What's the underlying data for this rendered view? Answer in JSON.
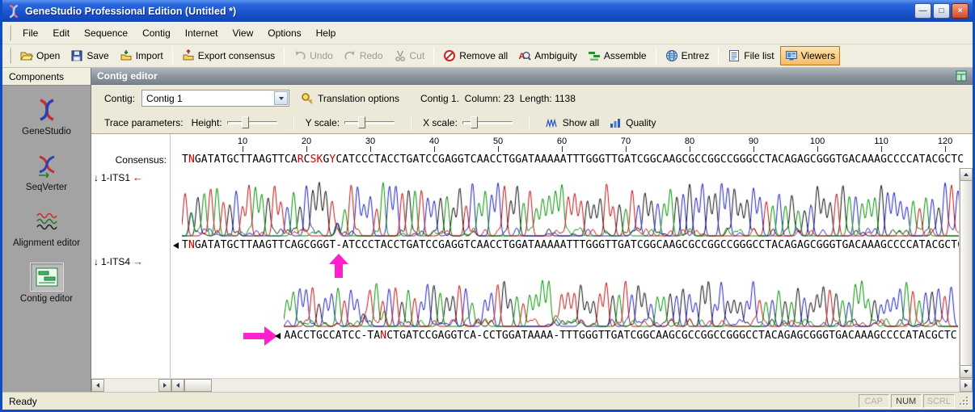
{
  "window": {
    "title": "GeneStudio Professional Edition (Untitled *)",
    "controls": {
      "minimize": "—",
      "restore": "□",
      "close": "×"
    }
  },
  "menu": [
    "File",
    "Edit",
    "Sequence",
    "Contig",
    "Internet",
    "View",
    "Options",
    "Help"
  ],
  "toolbar": [
    {
      "type": "button",
      "label": "Open",
      "icon": "open",
      "enabled": true
    },
    {
      "type": "button",
      "label": "Save",
      "icon": "save",
      "enabled": true
    },
    {
      "type": "button",
      "label": "Import",
      "icon": "import",
      "enabled": true
    },
    {
      "type": "sep"
    },
    {
      "type": "button",
      "label": "Export consensus",
      "icon": "export",
      "enabled": true
    },
    {
      "type": "sep"
    },
    {
      "type": "button",
      "label": "Undo",
      "icon": "undo",
      "enabled": false
    },
    {
      "type": "button",
      "label": "Redo",
      "icon": "redo",
      "enabled": false
    },
    {
      "type": "button",
      "label": "Cut",
      "icon": "cut",
      "enabled": false
    },
    {
      "type": "sep"
    },
    {
      "type": "button",
      "label": "Remove all",
      "icon": "remove",
      "enabled": true
    },
    {
      "type": "button",
      "label": "Ambiguity",
      "icon": "ambiguity",
      "enabled": true
    },
    {
      "type": "button",
      "label": "Assemble",
      "icon": "assemble",
      "enabled": true
    },
    {
      "type": "sep"
    },
    {
      "type": "button",
      "label": "Entrez",
      "icon": "entrez",
      "enabled": true
    },
    {
      "type": "sep"
    },
    {
      "type": "button",
      "label": "File list",
      "icon": "filelist",
      "enabled": true
    },
    {
      "type": "button",
      "label": "Viewers",
      "icon": "viewers",
      "enabled": true,
      "active": true
    }
  ],
  "sidebar": {
    "header": "Components",
    "items": [
      {
        "label": "GeneStudio",
        "icon": "genestudio",
        "selected": false
      },
      {
        "label": "SeqVerter",
        "icon": "seqverter",
        "selected": false
      },
      {
        "label": "Alignment editor",
        "icon": "alignment",
        "selected": false
      },
      {
        "label": "Contig editor",
        "icon": "contig",
        "selected": true
      }
    ]
  },
  "panel": {
    "title": "Contig editor",
    "contig_label": "Contig:",
    "contig_value": "Contig 1",
    "translation_options": "Translation options",
    "info": "Contig 1.  Column: 23  Length: 1138",
    "trace_params": {
      "label": "Trace parameters:",
      "sliders": [
        {
          "label": "Height:",
          "value": 30
        },
        {
          "label": "Y scale:",
          "value": 28
        },
        {
          "label": "X scale:",
          "value": 16
        }
      ],
      "buttons": [
        {
          "label": "Show all",
          "icon": "showall"
        },
        {
          "label": "Quality",
          "icon": "quality"
        }
      ]
    },
    "ruler": {
      "start": 10,
      "end": 120,
      "step": 10
    },
    "consensus_label": "Consensus:",
    "consensus": "TNGATATGCTTAAGTTCARCSKGYCATCCCTACCTGATCCGAGGTCAACCTGGATAAAAATTTGGGTTGATCGGCAAGCGCCGGCCGGGCCTACAGAGCGGGTGACAAAGCCCCATACGCTC",
    "expander": "↓",
    "reads": [
      {
        "name": "1-ITS1",
        "arrow": "←",
        "arrow_color": "#cc0000",
        "offset": 0,
        "sequence": "TNGATATGCTTAAGTTCAGCGGGT-ATCCCTACCTGATCCGAGGTCAACCTGGATAAAAATTTGGGTTGATCGGCAAGCGCCGGCCGGGCCTACAGAGCGGGTGACAAAGCCCCATACGCTC"
      },
      {
        "name": "1-ITS4",
        "arrow": "→",
        "arrow_color": "#009000",
        "offset": 16,
        "sequence": "AACCTGCCATCC-TANCTGATCCGAGGTCA-CCTGGATAAAA-TTTGGGTTGATCGGCAAGCGCCGGCCGGGCCTACAGAGCGGGTGACAAAGCCCCATACGCTC"
      }
    ]
  },
  "status": {
    "ready": "Ready",
    "cells": [
      {
        "label": "CAP",
        "active": false
      },
      {
        "label": "NUM",
        "active": true
      },
      {
        "label": "SCRL",
        "active": false
      }
    ]
  },
  "colors": {
    "trace_A": "#009000",
    "trace_C": "#2020c0",
    "trace_G": "#101010",
    "trace_T": "#c01010",
    "ambiguity": "#cc0000",
    "annotation": "#ff22cc"
  }
}
